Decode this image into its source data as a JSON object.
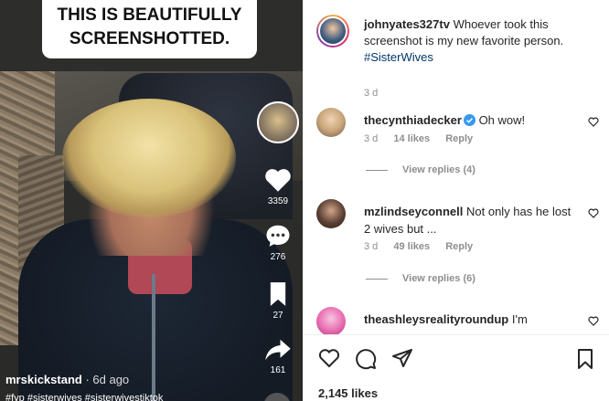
{
  "video": {
    "caption_line1": "THIS IS BEAUTIFULLY",
    "caption_line2": "SCREENSHOTTED.",
    "likes": "3359",
    "comments": "276",
    "saves": "27",
    "shares": "161",
    "creator": "mrskickstand",
    "creator_ago": "· 6d ago",
    "hashtags": "#fyp #sisterwives #sisterwivestiktok"
  },
  "post": {
    "username": "johnyates327tv",
    "caption": "Whoever took this screenshot is my new favorite person.",
    "hashtag": "#SisterWives",
    "age": "3 d"
  },
  "comments": [
    {
      "username": "thecynthiadecker",
      "verified": true,
      "text": "Oh wow!",
      "age": "3 d",
      "likes": "14 likes",
      "reply_label": "Reply",
      "view_replies": "View replies (4)",
      "avatar_color": "#c9a77c"
    },
    {
      "username": "mzlindseyconnell",
      "verified": false,
      "text": "Not only has he lost 2 wives but ...",
      "age": "3 d",
      "likes": "49 likes",
      "reply_label": "Reply",
      "view_replies": "View replies (6)",
      "avatar_color": "#5b4034"
    },
    {
      "username": "theashleysrealityroundup",
      "verified": false,
      "text": "I'm",
      "avatar_color": "#e96bb0"
    }
  ],
  "actions": {
    "likes_count": "2,145 likes"
  },
  "colors": {
    "link": "#00376b",
    "muted": "#8e8e8e",
    "verified_blue": "#3897f0"
  }
}
